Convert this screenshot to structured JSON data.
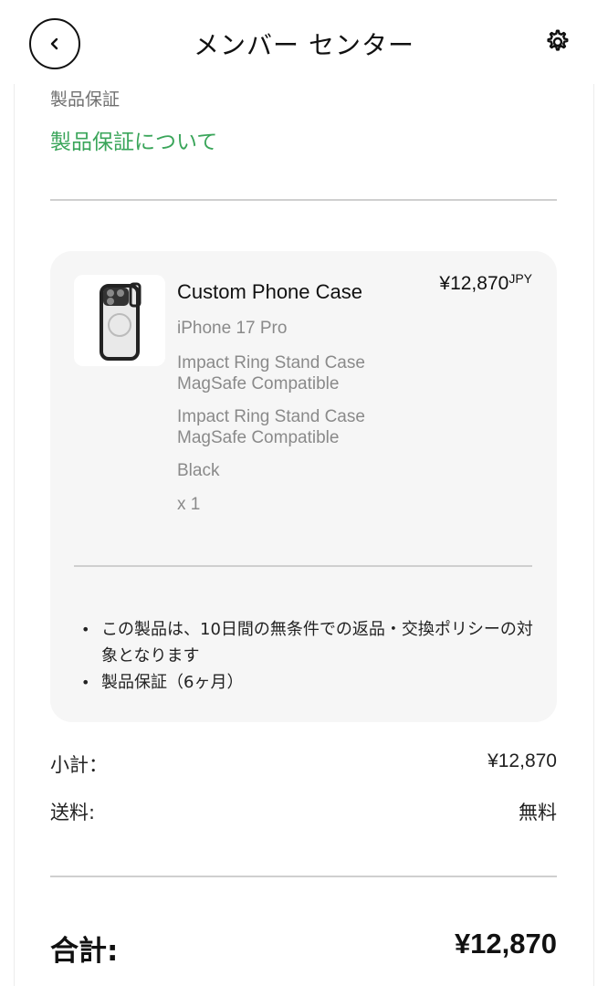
{
  "header": {
    "title": "メンバー センター",
    "back_icon": "chevron-left-icon",
    "settings_icon": "gear-icon"
  },
  "warranty": {
    "heading": "製品保証",
    "link": "製品保証について"
  },
  "product": {
    "name": "Custom Phone Case",
    "price": "¥12,870",
    "currency": "JPY",
    "options": [
      "iPhone 17 Pro",
      "Impact Ring Stand Case\nMagSafe Compatible",
      "Impact Ring Stand Case\nMagSafe Compatible",
      "Black",
      "x 1"
    ],
    "policies": [
      "この製品は、10日間の無条件での返品・交換ポリシーの対象となります",
      "製品保証（6ヶ月）"
    ]
  },
  "summary": {
    "subtotal_label": "小計：",
    "subtotal_value": "¥12,870",
    "shipping_label": "送料:",
    "shipping_value": "無料",
    "total_label": "合計:",
    "total_value": "¥12,870"
  },
  "colors": {
    "link_green": "#3aa55a",
    "card_bg": "#f6f6f6",
    "muted_text": "#8a8a8a"
  }
}
